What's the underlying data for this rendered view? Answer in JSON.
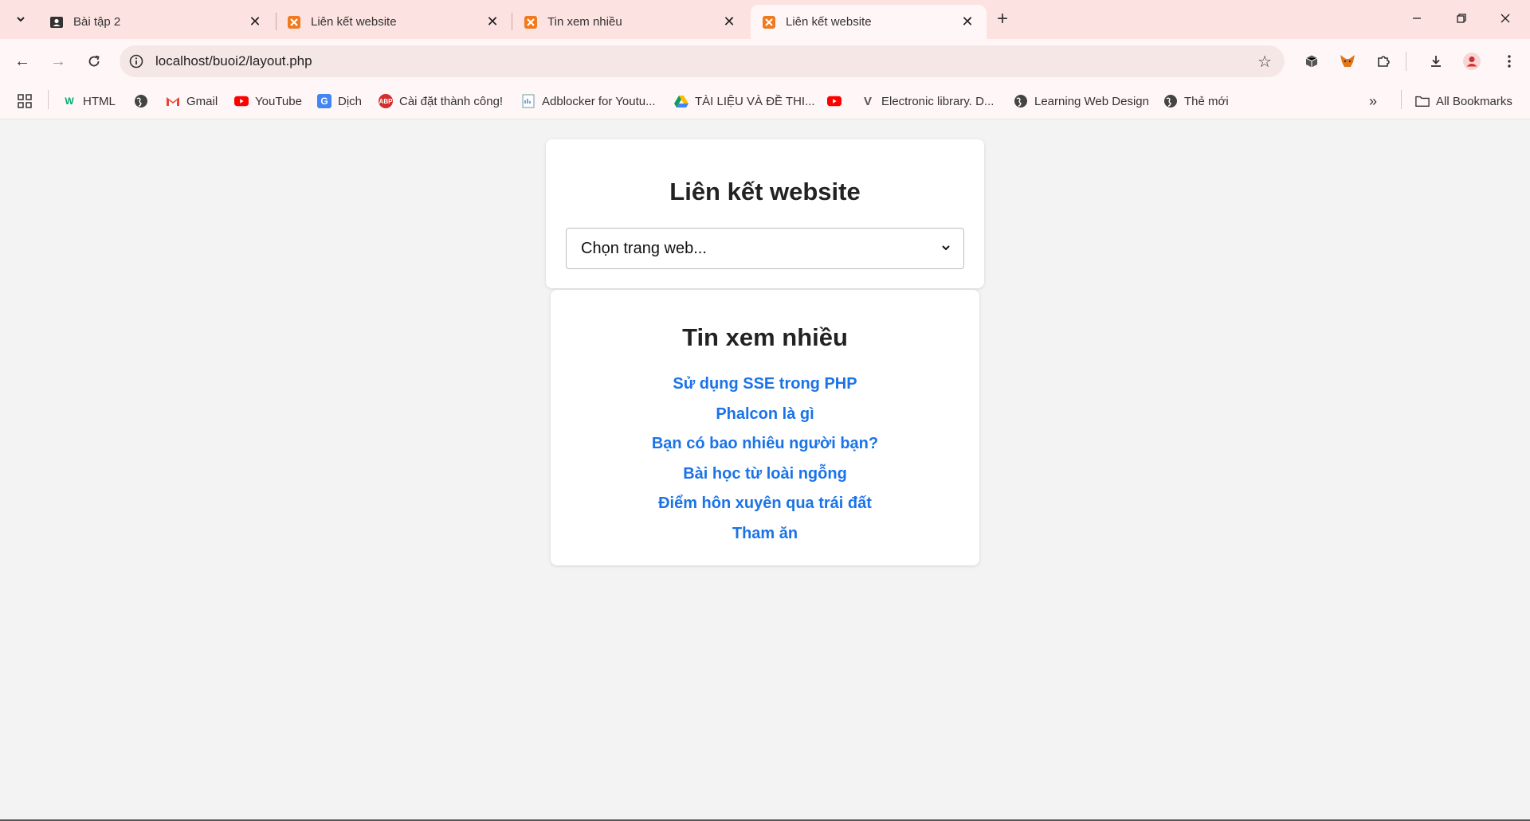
{
  "colors": {
    "tab_strip": "#fde2e2",
    "toolbar": "#fff7f7",
    "link": "#1a73e8",
    "page_bg": "#f3f3f3"
  },
  "tabs": [
    {
      "title": "Bài tập 2",
      "icon": "profile-icon",
      "active": false
    },
    {
      "title": "Liên kết website",
      "icon": "xampp-icon",
      "active": false
    },
    {
      "title": "Tin xem nhiều",
      "icon": "xampp-icon",
      "active": false
    },
    {
      "title": "Liên kết website",
      "icon": "xampp-icon",
      "active": true
    }
  ],
  "address_bar": {
    "url": "localhost/buoi2/layout.php"
  },
  "bookmarks": [
    {
      "label": "HTML",
      "icon": "w3schools-icon"
    },
    {
      "label": "",
      "icon": "globe-icon"
    },
    {
      "label": "Gmail",
      "icon": "gmail-icon"
    },
    {
      "label": "YouTube",
      "icon": "youtube-icon"
    },
    {
      "label": "Dịch",
      "icon": "translate-icon"
    },
    {
      "label": "Cài đặt thành công!",
      "icon": "abp-icon"
    },
    {
      "label": "Adblocker for Youtu...",
      "icon": "page-icon"
    },
    {
      "label": "TÀI LIỆU VÀ ĐỀ THI...",
      "icon": "drive-icon"
    },
    {
      "label": "",
      "icon": "youtube-icon"
    },
    {
      "label": "Electronic library. D...",
      "icon": "v-icon"
    },
    {
      "label": "Learning Web Design",
      "icon": "globe-icon"
    },
    {
      "label": "Thẻ mới",
      "icon": "globe-icon"
    }
  ],
  "all_bookmarks_label": "All Bookmarks",
  "main": {
    "website_card": {
      "title": "Liên kết website",
      "select_value": "Chọn trang web..."
    },
    "news_card": {
      "title": "Tin xem nhiều",
      "links": [
        "Sử dụng SSE trong PHP",
        "Phalcon là gì",
        "Bạn có bao nhiêu người bạn?",
        "Bài học từ loài ngỗng",
        "Điểm hôn xuyên qua trái đất",
        "Tham ăn"
      ]
    }
  }
}
